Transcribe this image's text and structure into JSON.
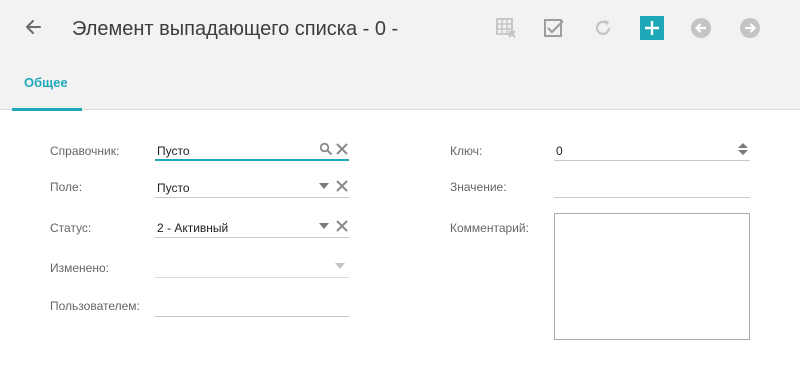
{
  "header": {
    "title": "Элемент выпадающего списка - 0 -",
    "back_icon": "arrow-left-icon",
    "toolbar": [
      {
        "name": "table-remove-icon"
      },
      {
        "name": "checkbox-check-icon"
      },
      {
        "name": "refresh-icon"
      },
      {
        "name": "add-icon"
      },
      {
        "name": "previous-icon"
      },
      {
        "name": "next-icon"
      }
    ]
  },
  "tabs": [
    {
      "label": "Общее",
      "active": true
    }
  ],
  "form": {
    "directory": {
      "label": "Справочник:",
      "value": "Пусто"
    },
    "field": {
      "label": "Поле:",
      "value": "Пусто"
    },
    "status": {
      "label": "Статус:",
      "value": "2 - Активный"
    },
    "modified": {
      "label": "Изменено:",
      "value": ""
    },
    "by_user": {
      "label": "Пользователем:",
      "value": ""
    },
    "key": {
      "label": "Ключ:",
      "value": "0"
    },
    "value": {
      "label": "Значение:",
      "value": ""
    },
    "comment": {
      "label": "Комментарий:",
      "value": ""
    }
  },
  "colors": {
    "accent": "#1fa8b8",
    "icon_gray": "#9e9e9e",
    "icon_light": "#c4c4c4",
    "header_bg": "#f2f2f2"
  }
}
